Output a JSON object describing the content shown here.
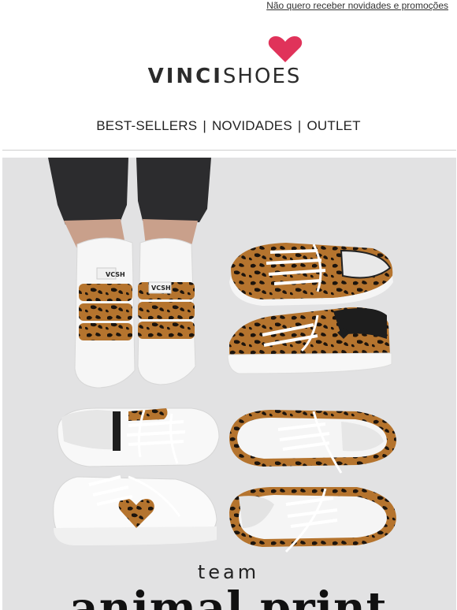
{
  "header": {
    "unsubscribe_link": "Não quero receber novidades e promoções"
  },
  "brand": {
    "name_bold": "VINCI",
    "name_light": "SHOES",
    "heart_color": "#e0335a",
    "logo_icon": "heart-icon"
  },
  "nav": {
    "items": [
      "BEST-SELLERS",
      "NOVIDADES",
      "OUTLET"
    ],
    "separator": "|"
  },
  "hero": {
    "line1": "team",
    "line2": "animal print",
    "background_color": "#e2e2e3",
    "sneaker_tag_text": "VCSH"
  }
}
